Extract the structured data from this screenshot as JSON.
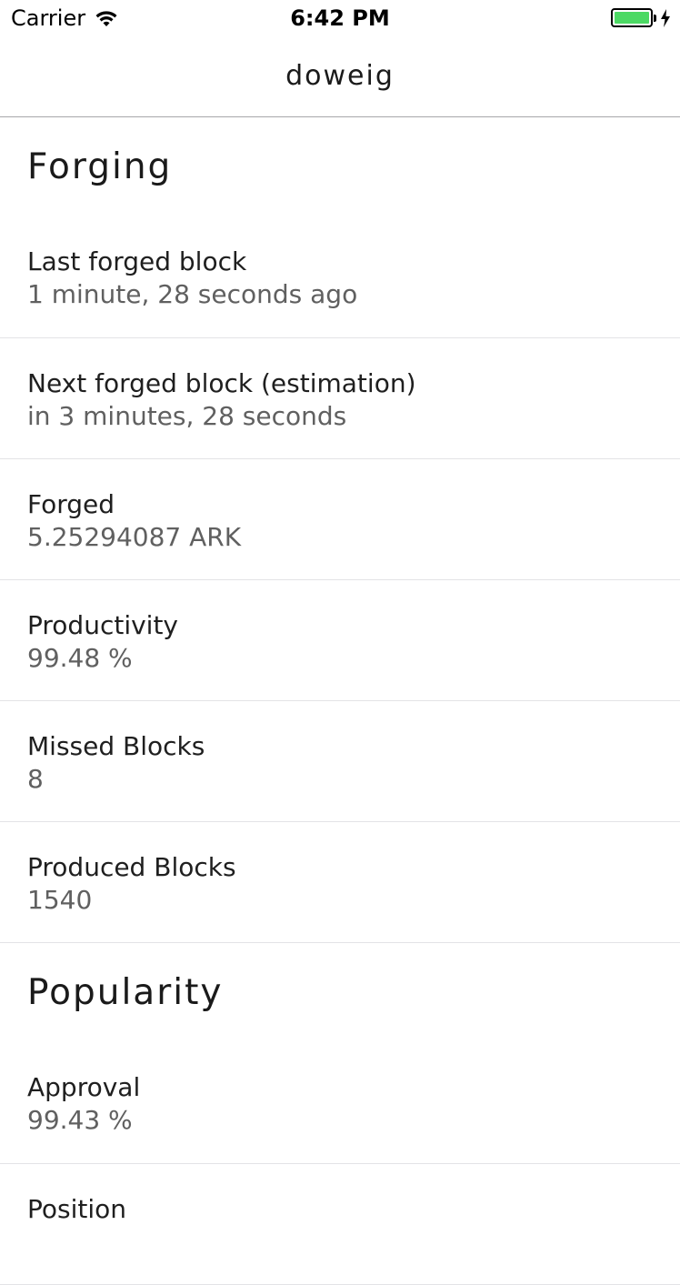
{
  "status_bar": {
    "carrier": "Carrier",
    "time": "6:42 PM",
    "battery_color": "#4cd964"
  },
  "nav": {
    "title": "doweig"
  },
  "sections": [
    {
      "title": "Forging",
      "rows": [
        {
          "label": "Last forged block",
          "value": "1 minute, 28 seconds ago"
        },
        {
          "label": "Next forged block (estimation)",
          "value": "in 3 minutes, 28 seconds"
        },
        {
          "label": "Forged",
          "value": "5.25294087 ARK"
        },
        {
          "label": "Productivity",
          "value": "99.48 %"
        },
        {
          "label": "Missed Blocks",
          "value": "8"
        },
        {
          "label": "Produced Blocks",
          "value": "1540"
        }
      ]
    },
    {
      "title": "Popularity",
      "rows": [
        {
          "label": "Approval",
          "value": "99.43 %"
        },
        {
          "label": "Position",
          "value": ""
        }
      ]
    }
  ]
}
